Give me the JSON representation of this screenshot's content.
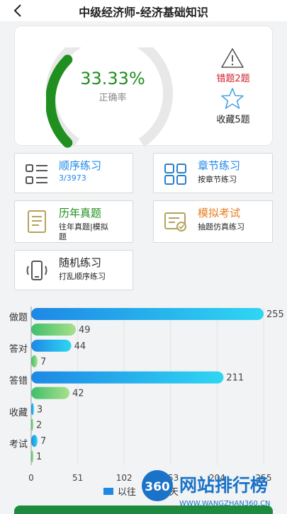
{
  "header": {
    "title": "中级经济师-经济基础知识"
  },
  "stats": {
    "rate": "33.33%",
    "rate_fraction": 0.3333,
    "rate_label": "正确率",
    "wrong": "错题2题",
    "favorites": "收藏5题"
  },
  "tiles": {
    "sequential": {
      "title": "顺序练习",
      "sub": "3/3973"
    },
    "chapter": {
      "title": "章节练习",
      "sub": "按章节练习"
    },
    "past": {
      "title": "历年真题",
      "sub1": "往年真题|模拟",
      "sub2": "题"
    },
    "mock": {
      "title": "模拟考试",
      "sub": "抽题仿真练习"
    },
    "random": {
      "title": "随机练习",
      "sub": "打乱顺序练习"
    }
  },
  "colors": {
    "accent_green": "#1f8f1f",
    "blue": "#1e88e5",
    "orange": "#e67e22",
    "red": "#d0202a"
  },
  "chart_data": {
    "type": "bar",
    "orientation": "horizontal",
    "categories": [
      "做题",
      "答对",
      "答错",
      "收藏",
      "考试"
    ],
    "series": [
      {
        "name": "以往",
        "values": [
          255,
          44,
          211,
          3,
          7
        ]
      },
      {
        "name": "今天",
        "values": [
          49,
          7,
          42,
          2,
          1
        ]
      }
    ],
    "xticks": [
      "0",
      "51",
      "102",
      "153",
      "204",
      "255"
    ],
    "xlim": [
      0,
      255
    ],
    "grid": true,
    "legend": "bottom"
  },
  "watermark": {
    "badge": "360",
    "name": "网站排行榜",
    "url": "WWW.WANGZHAN360.CN"
  }
}
